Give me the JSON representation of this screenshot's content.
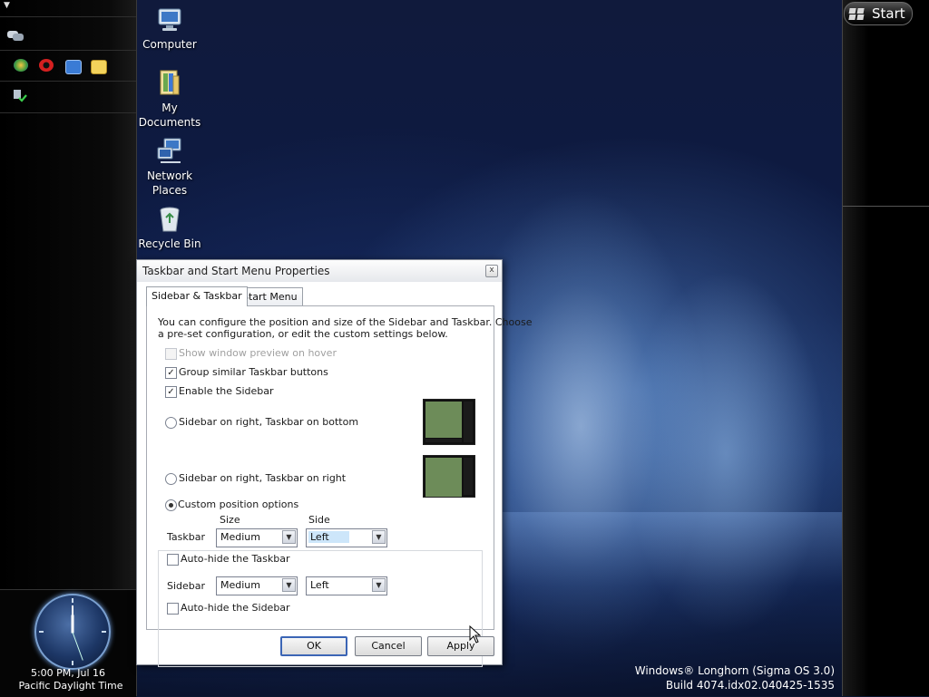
{
  "desktop": {
    "icons": [
      {
        "label": "Computer",
        "icon": "computer-icon"
      },
      {
        "label": "My Documents",
        "icon": "folder-documents-icon"
      },
      {
        "label": "Network Places",
        "icon": "network-icon"
      },
      {
        "label": "Recycle Bin",
        "icon": "recycle-bin-icon"
      }
    ],
    "watermark": {
      "line1": "Windows® Longhorn (Sigma OS 3.0)",
      "line2": "Build 4074.idx02.040425-1535"
    }
  },
  "sidebar": {
    "quick_launch_icons": [
      "browser-icon",
      "opera-icon",
      "desktop-icon",
      "folder-icon"
    ],
    "tray_icons": [
      "messenger-icon",
      "network-status-icon"
    ],
    "clock": {
      "time": "5:00 PM, Jul 16",
      "timezone": "Pacific Daylight Time"
    }
  },
  "taskbar": {
    "start_label": "Start"
  },
  "dialog": {
    "title": "Taskbar and Start Menu Properties",
    "tabs": [
      {
        "label": "Sidebar & Taskbar",
        "active": true
      },
      {
        "label": "Start Menu",
        "active": false
      }
    ],
    "description": "You can configure the position and size of the Sidebar and Taskbar. Choose a pre-set configuration, or edit the custom settings below.",
    "description_line1": "You can configure the position and size of the Sidebar and Taskbar. Choose",
    "description_line2": "a pre-set configuration, or edit the custom settings below.",
    "checkboxes": [
      {
        "label": "Show window preview on hover",
        "checked": false,
        "disabled": true
      },
      {
        "label": "Group similar Taskbar buttons",
        "checked": true,
        "disabled": false
      },
      {
        "label": "Enable the Sidebar",
        "checked": true,
        "disabled": false
      }
    ],
    "radios": [
      {
        "label": "Sidebar on right, Taskbar on bottom",
        "selected": false
      },
      {
        "label": "Sidebar on right, Taskbar on right",
        "selected": false
      },
      {
        "label": "Custom position options",
        "selected": true
      }
    ],
    "custom": {
      "size_header": "Size",
      "side_header": "Side",
      "taskbar_label": "Taskbar",
      "taskbar_size": "Medium",
      "taskbar_side": "Left",
      "autohide_taskbar_label": "Auto-hide the Taskbar",
      "autohide_taskbar_checked": false,
      "sidebar_label": "Sidebar",
      "sidebar_size": "Medium",
      "sidebar_side": "Left",
      "autohide_sidebar_label": "Auto-hide the Sidebar",
      "autohide_sidebar_checked": false
    },
    "buttons": {
      "ok": "OK",
      "cancel": "Cancel",
      "apply": "Apply"
    },
    "close_glyph": "x"
  }
}
